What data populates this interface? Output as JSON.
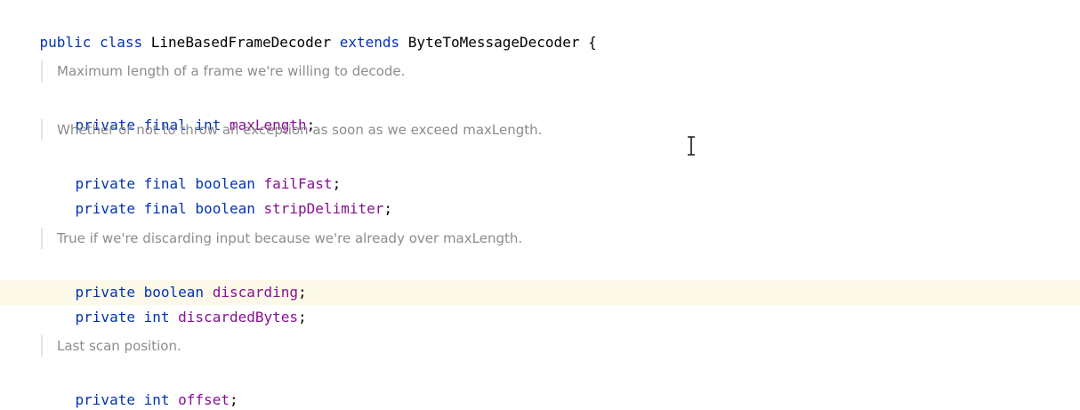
{
  "class_decl": {
    "kw_public": "public",
    "kw_class": "class",
    "class_name": "LineBasedFrameDecoder",
    "kw_extends": "extends",
    "super_name": "ByteToMessageDecoder",
    "brace": "{"
  },
  "doc_comments": {
    "max_length": "Maximum length of a frame we're willing to decode.",
    "fail_fast": "Whether or not to throw an exception as soon as we exceed maxLength.",
    "discarding": "True if we're discarding input because we're already over maxLength.",
    "offset": "Last scan position."
  },
  "fields": {
    "max_length": {
      "mod1": "private",
      "mod2": "final",
      "type": "int",
      "name": "maxLength",
      "end": ";"
    },
    "fail_fast": {
      "mod1": "private",
      "mod2": "final",
      "type": "boolean",
      "name": "failFast",
      "end": ";"
    },
    "strip_delimiter": {
      "mod1": "private",
      "mod2": "final",
      "type": "boolean",
      "name": "stripDelimiter",
      "end": ";"
    },
    "discarding": {
      "mod1": "private",
      "type": "boolean",
      "name": "discarding",
      "end": ";"
    },
    "discarded_bytes": {
      "mod1": "private",
      "type": "int",
      "name": "discardedBytes",
      "end": ";"
    },
    "offset": {
      "mod1": "private",
      "type": "int",
      "name": "offset",
      "end": ";"
    }
  },
  "colors": {
    "keyword": "#0033b3",
    "field": "#871094",
    "doc_comment": "#8c8c8c",
    "caret_row_highlight": "#fdf9e9"
  },
  "icons": {
    "cursor": "text-cursor-icon"
  }
}
